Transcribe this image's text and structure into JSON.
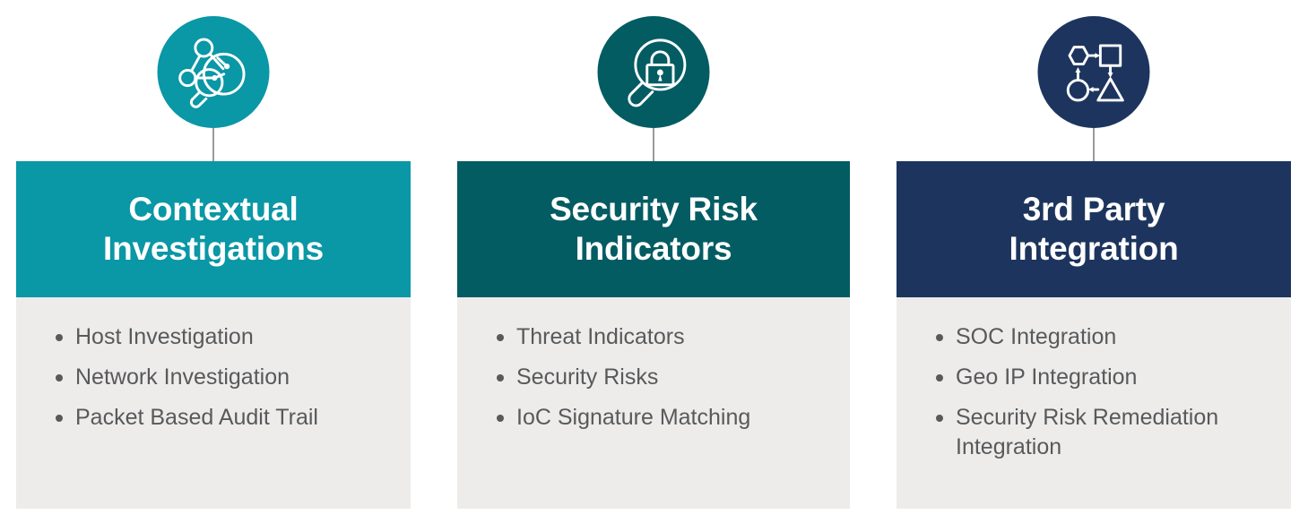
{
  "page": {
    "background_color": "#ffffff",
    "body_color": "#edeceb",
    "text_color": "#58595b"
  },
  "columns": [
    {
      "id": "contextual-investigations",
      "title": "Contextual\nInvestigations",
      "accent_color": "#0a97a6",
      "icon": "network-graph-magnifier-icon",
      "items": [
        "Host Investigation",
        "Network Investigation",
        "Packet Based Audit Trail"
      ]
    },
    {
      "id": "security-risk-indicators",
      "title": "Security Risk\nIndicators",
      "accent_color": "#045c63",
      "icon": "magnifier-padlock-icon",
      "items": [
        "Threat Indicators",
        "Security Risks",
        "IoC Signature Matching"
      ]
    },
    {
      "id": "3rd-party-integration",
      "title": "3rd Party\nIntegration",
      "accent_color": "#1d355e",
      "icon": "shapes-workflow-integration-icon",
      "items": [
        "SOC Integration",
        "Geo IP Integration",
        "Security Risk Remediation Integration"
      ]
    }
  ]
}
